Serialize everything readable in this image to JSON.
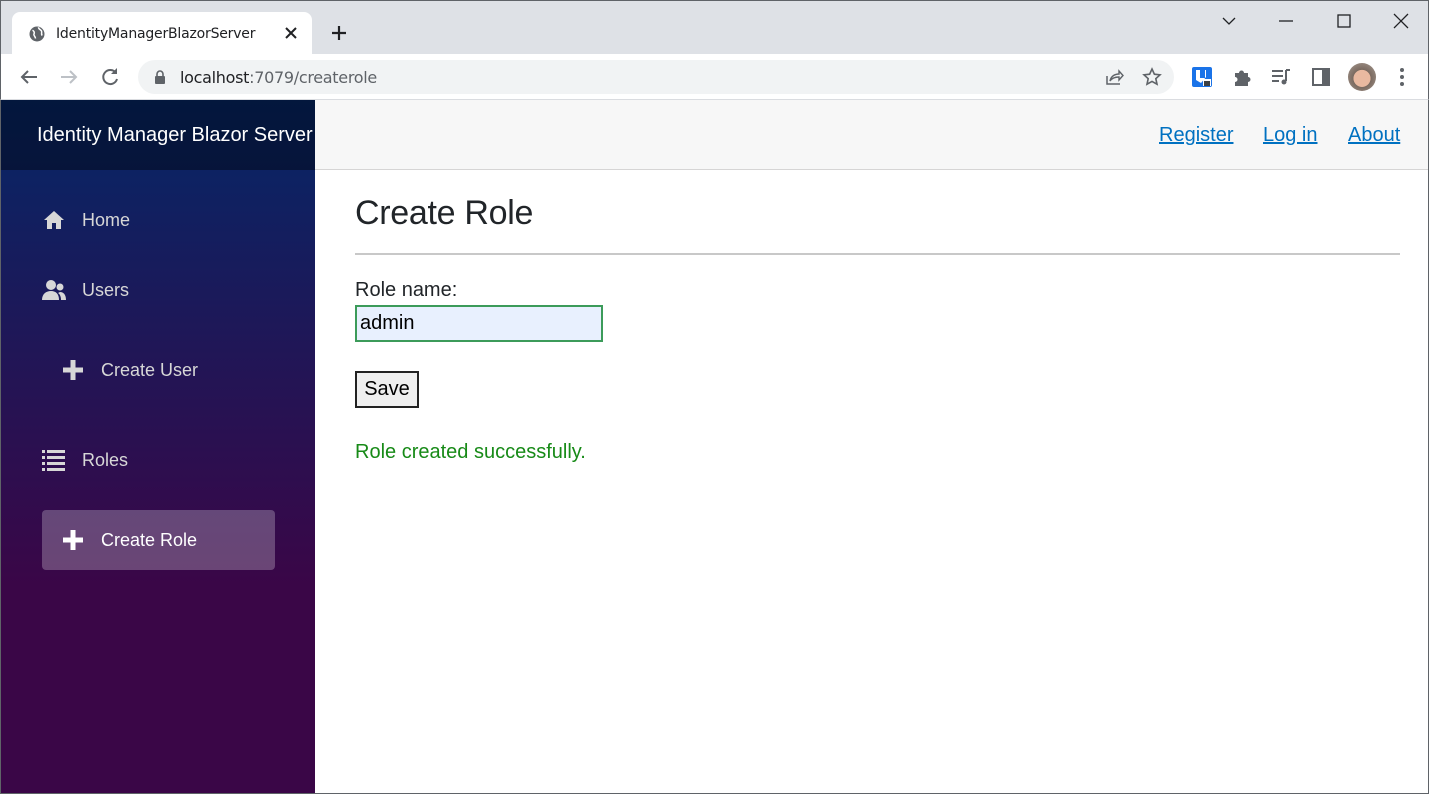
{
  "browser": {
    "tab_title": "IdentityManagerBlazorServer",
    "url_host": "localhost",
    "url_path": ":7079/createrole",
    "icons": [
      "globe-icon",
      "close-icon",
      "new-tab-icon",
      "tab-search-icon",
      "minimize-icon",
      "maximize-icon",
      "window-close-icon",
      "back-icon",
      "forward-icon",
      "reload-icon",
      "lock-icon",
      "share-icon",
      "bookmark-star-icon",
      "extension-password-icon",
      "extensions-puzzle-icon",
      "media-queue-icon",
      "side-panel-icon",
      "profile-avatar",
      "menu-kebab-icon"
    ]
  },
  "app": {
    "brand": "Identity Manager Blazor Server",
    "top_links": {
      "register": "Register",
      "login": "Log in",
      "about": "About"
    },
    "sidebar": {
      "items": [
        {
          "label": "Home",
          "icon": "home-icon",
          "active": false
        },
        {
          "label": "Users",
          "icon": "users-icon",
          "active": false
        },
        {
          "label": "Create User",
          "icon": "plus-icon",
          "active": false
        },
        {
          "label": "Roles",
          "icon": "list-icon",
          "active": false
        },
        {
          "label": "Create Role",
          "icon": "plus-icon",
          "active": true
        }
      ]
    },
    "page": {
      "title": "Create Role",
      "role_name_label": "Role name:",
      "role_name_value": "admin",
      "save_label": "Save",
      "status_message": "Role created successfully."
    },
    "colors": {
      "link": "#0071c1",
      "success": "#178a17",
      "sidebar_top": "#052767",
      "sidebar_bottom": "#3a0647"
    }
  }
}
